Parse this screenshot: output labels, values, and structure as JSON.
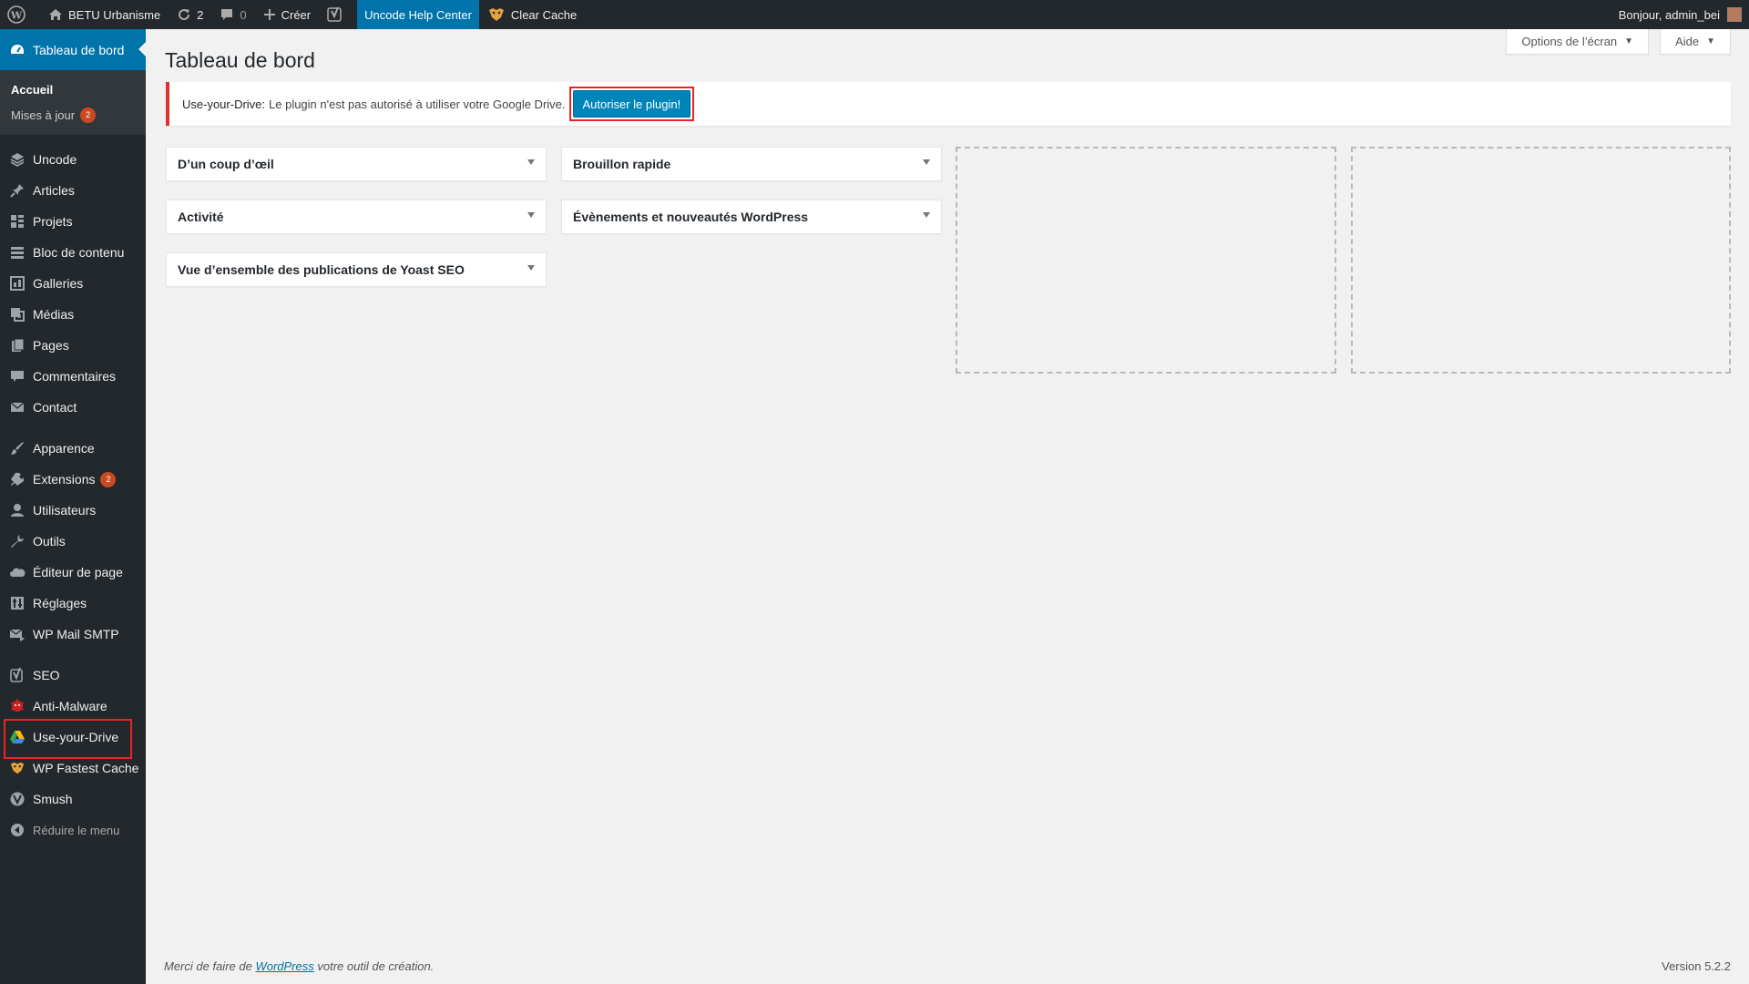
{
  "adminbar": {
    "site_name": "BETU Urbanisme",
    "updates_count": "2",
    "comments_count": "0",
    "new_label": "Créer",
    "help_center": "Uncode Help Center",
    "clear_cache": "Clear Cache",
    "greeting": "Bonjour, admin_bei"
  },
  "sidebar": {
    "dashboard": "Tableau de bord",
    "submenu": [
      {
        "label": "Accueil"
      },
      {
        "label": "Mises à jour",
        "badge": "2"
      }
    ],
    "items": [
      {
        "label": "Uncode",
        "icon": "layers-icon"
      },
      {
        "label": "Articles",
        "icon": "pushpin-icon"
      },
      {
        "label": "Projets",
        "icon": "grid-icon"
      },
      {
        "label": "Bloc de contenu",
        "icon": "list-icon"
      },
      {
        "label": "Galleries",
        "icon": "gallery-icon"
      },
      {
        "label": "Médias",
        "icon": "media-icon"
      },
      {
        "label": "Pages",
        "icon": "page-icon"
      },
      {
        "label": "Commentaires",
        "icon": "comment-icon"
      },
      {
        "label": "Contact",
        "icon": "mail-icon"
      },
      {
        "label": "Apparence",
        "icon": "brush-icon"
      },
      {
        "label": "Extensions",
        "icon": "plugin-icon",
        "badge": "2"
      },
      {
        "label": "Utilisateurs",
        "icon": "user-icon"
      },
      {
        "label": "Outils",
        "icon": "wrench-icon"
      },
      {
        "label": "Éditeur de page",
        "icon": "cloud-icon"
      },
      {
        "label": "Réglages",
        "icon": "settings-icon"
      },
      {
        "label": "WP Mail SMTP",
        "icon": "mail-smtp-icon"
      },
      {
        "label": "SEO",
        "icon": "yoast-icon"
      },
      {
        "label": "Anti-Malware",
        "icon": "malware-icon"
      },
      {
        "label": "Use-your-Drive",
        "icon": "drive-icon"
      },
      {
        "label": "WP Fastest Cache",
        "icon": "cheetah-icon"
      },
      {
        "label": "Smush",
        "icon": "smush-icon"
      }
    ],
    "collapse": "Réduire le menu"
  },
  "main": {
    "title": "Tableau de bord",
    "screen_options": "Options de l’écran",
    "help": "Aide",
    "notice": {
      "plugin": "Use-your-Drive:",
      "message": "Le plugin n'est pas autorisé à utiliser votre Google Drive.",
      "button": "Autoriser le plugin!"
    },
    "widgets": [
      "D’un coup d’œil",
      "Activité",
      "Vue d’ensemble des publications de Yoast SEO",
      "Brouillon rapide",
      "Évènements et nouveautés WordPress"
    ],
    "footer": {
      "thanks_prefix": "Merci de faire de",
      "thanks_link": "WordPress",
      "thanks_suffix": "votre outil de création.",
      "version": "Version 5.2.2"
    }
  },
  "colors": {
    "accent": "#0073aa",
    "sidebar_bg": "#23282d",
    "error": "#dc3232",
    "badge": "#ca4a1f"
  }
}
